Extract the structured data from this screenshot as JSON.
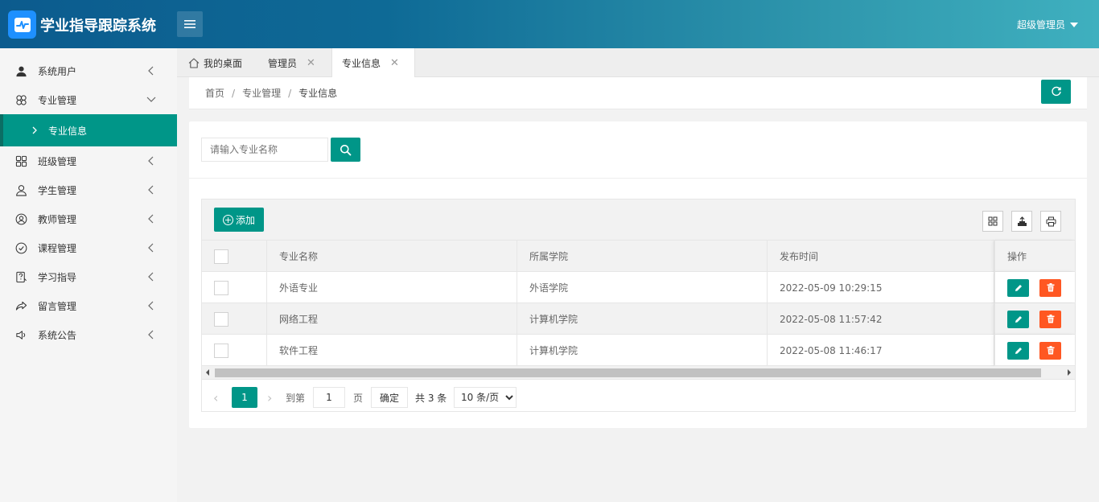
{
  "header": {
    "app_title": "学业指导跟踪系统",
    "user_name": "超级管理员"
  },
  "sidebar": {
    "items": [
      {
        "label": "系统用户",
        "icon": "user-icon"
      },
      {
        "label": "专业管理",
        "icon": "clover-icon",
        "expanded": true
      },
      {
        "label": "专业信息",
        "sub": true,
        "active": true
      },
      {
        "label": "班级管理",
        "icon": "grid-icon"
      },
      {
        "label": "学生管理",
        "icon": "person-outline-icon"
      },
      {
        "label": "教师管理",
        "icon": "user-circle-icon"
      },
      {
        "label": "课程管理",
        "icon": "check-circle-icon"
      },
      {
        "label": "学习指导",
        "icon": "help-doc-icon"
      },
      {
        "label": "留言管理",
        "icon": "share-icon"
      },
      {
        "label": "系统公告",
        "icon": "speaker-icon"
      }
    ]
  },
  "tabs": [
    {
      "label": "我的桌面",
      "icon": "home-icon"
    },
    {
      "label": "管理员",
      "closable": true
    },
    {
      "label": "专业信息",
      "closable": true,
      "active": true
    }
  ],
  "breadcrumb": {
    "home": "首页",
    "parent": "专业管理",
    "current": "专业信息",
    "sep": "/"
  },
  "search": {
    "placeholder": "请输入专业名称",
    "value": ""
  },
  "toolbar": {
    "add_label": "添加"
  },
  "table": {
    "columns": [
      "专业名称",
      "所属学院",
      "发布时间",
      "操作"
    ],
    "rows": [
      {
        "name": "外语专业",
        "college": "外语学院",
        "time": "2022-05-09 10:29:15"
      },
      {
        "name": "网络工程",
        "college": "计算机学院",
        "time": "2022-05-08 11:57:42"
      },
      {
        "name": "软件工程",
        "college": "计算机学院",
        "time": "2022-05-08 11:46:17"
      }
    ]
  },
  "pager": {
    "current_page": "1",
    "goto_label": "到第",
    "page_input": "1",
    "page_unit": "页",
    "confirm_label": "确定",
    "total_label": "共 3 条",
    "page_size": "10 条/页",
    "prev": "‹",
    "next": "›"
  },
  "colors": {
    "primary": "#009688",
    "danger": "#ff5722",
    "header_start": "#0c5b8e",
    "header_end": "#3fb0bf"
  }
}
